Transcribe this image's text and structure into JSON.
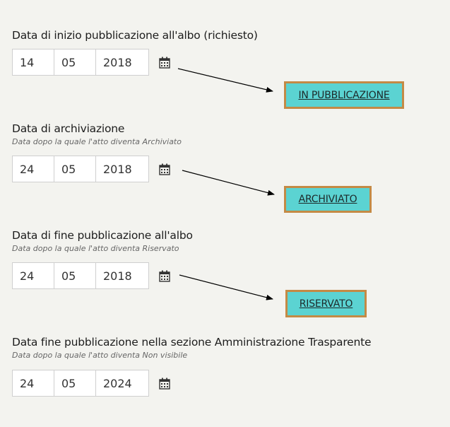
{
  "sections": [
    {
      "label": "Data di inizio pubblicazione all'albo (richiesto)",
      "hint": "",
      "day": "14",
      "month": "05",
      "year": "2018",
      "status": "IN PUBBLICAZIONE"
    },
    {
      "label": "Data di archiviazione",
      "hint": "Data dopo la quale l'atto diventa Archiviato",
      "day": "24",
      "month": "05",
      "year": "2018",
      "status": "ARCHIVIATO"
    },
    {
      "label": "Data di fine pubblicazione all'albo",
      "hint": "Data dopo la quale l'atto diventa Riservato",
      "day": "24",
      "month": "05",
      "year": "2018",
      "status": "RISERVATO"
    },
    {
      "label": "Data fine pubblicazione nella sezione Amministrazione Trasparente",
      "hint": "Data dopo la quale l'atto diventa Non visibile",
      "day": "24",
      "month": "05",
      "year": "2024"
    }
  ],
  "icons": {
    "calendar": "calendar-icon"
  },
  "colors": {
    "background": "#f3f3ef",
    "status_fill": "#5bd3d2",
    "status_border": "#c48a45"
  }
}
